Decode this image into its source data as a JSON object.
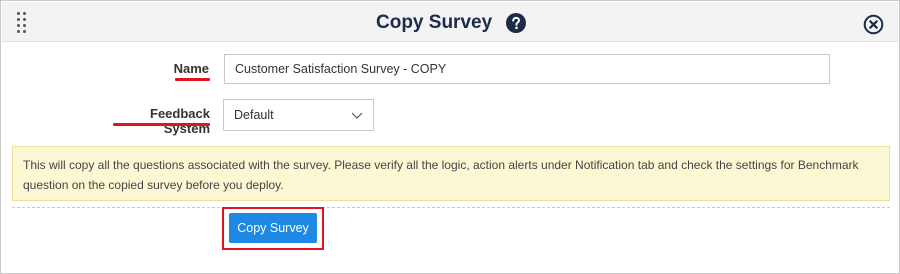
{
  "dialog": {
    "title": "Copy Survey"
  },
  "form": {
    "name_label": "Name",
    "name_value": "Customer Satisfaction Survey - COPY",
    "feedback_label": "Feedback System",
    "feedback_selected": "Default"
  },
  "notice": {
    "text": "This will copy all the questions associated with the survey. Please verify all the logic, action alerts under Notification tab and check the settings for Benchmark question on the copied survey before you deploy."
  },
  "actions": {
    "copy_label": "Copy Survey"
  },
  "colors": {
    "accent": "#1e88e5",
    "highlight": "#e0141e",
    "notice_bg": "#fdf8d4",
    "title": "#1c2b4a"
  },
  "icons": [
    "drag-handle-icon",
    "help-icon",
    "close-icon",
    "chevron-down-icon"
  ]
}
